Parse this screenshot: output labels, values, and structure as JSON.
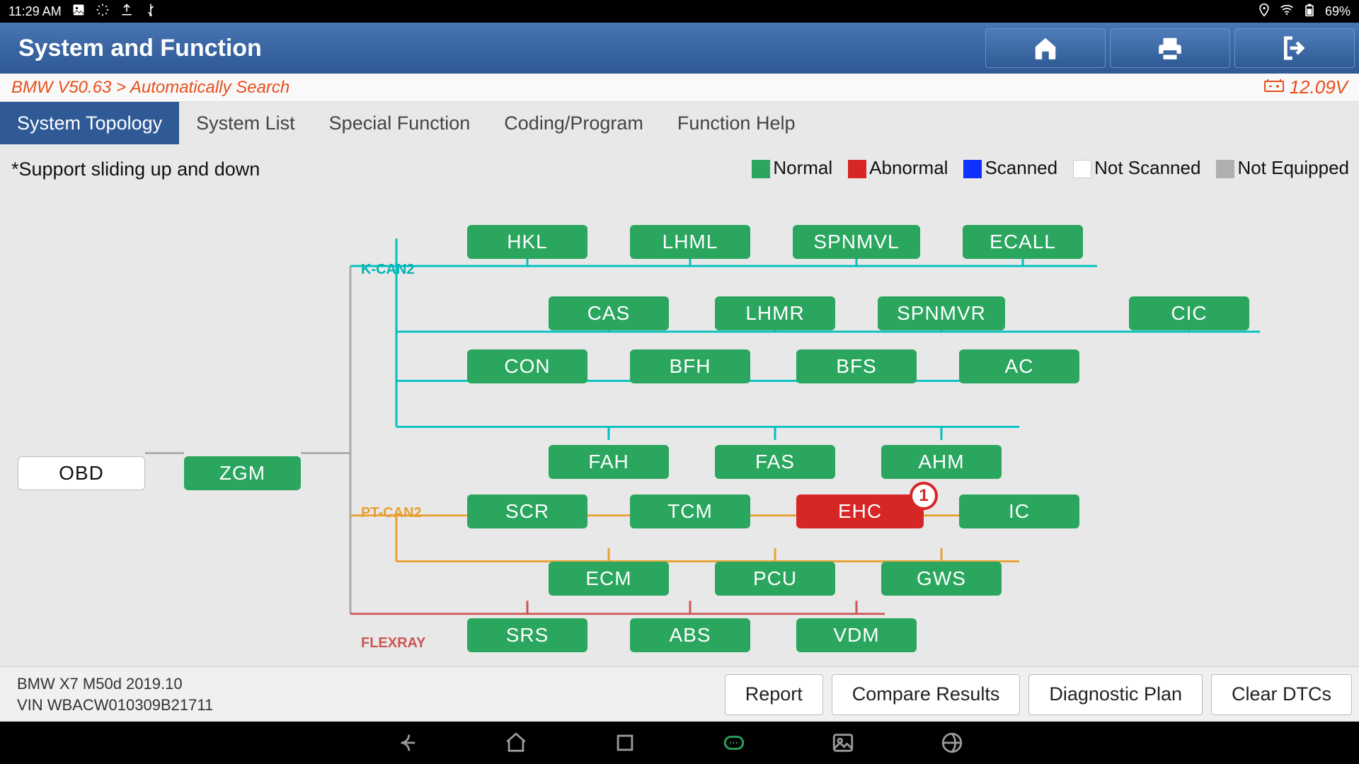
{
  "status": {
    "time": "11:29 AM",
    "battery": "69%"
  },
  "header": {
    "title": "System and Function"
  },
  "crumb": "BMW V50.63 > Automatically Search",
  "voltage": "12.09V",
  "tabs": [
    "System Topology",
    "System List",
    "Special Function",
    "Coding/Program",
    "Function Help"
  ],
  "active_tab": 0,
  "hint": "*Support sliding up and down",
  "legend": {
    "normal": "Normal",
    "abnormal": "Abnormal",
    "scanned": "Scanned",
    "notscanned": "Not Scanned",
    "notequip": "Not Equipped"
  },
  "buses": {
    "kcan2": "K-CAN2",
    "ptcan2": "PT-CAN2",
    "flexray": "FLEXRAY"
  },
  "root_nodes": {
    "obd": "OBD",
    "zgm": "ZGM"
  },
  "topology": {
    "kcan2": {
      "row1": [
        "HKL",
        "LHML",
        "SPNMVL",
        "ECALL"
      ],
      "row2": [
        "CAS",
        "LHMR",
        "SPNMVR",
        "CIC"
      ],
      "row3": [
        "CON",
        "BFH",
        "BFS",
        "AC"
      ],
      "row4": [
        "FAH",
        "FAS",
        "AHM"
      ]
    },
    "ptcan2": {
      "row1": [
        {
          "name": "SCR",
          "status": "normal"
        },
        {
          "name": "TCM",
          "status": "normal"
        },
        {
          "name": "EHC",
          "status": "abnormal",
          "badge": "1"
        },
        {
          "name": "IC",
          "status": "normal"
        }
      ],
      "row2": [
        "ECM",
        "PCU",
        "GWS"
      ]
    },
    "flexray": {
      "row1": [
        "SRS",
        "ABS",
        "VDM"
      ]
    }
  },
  "vehicle": {
    "model": "BMW X7 M50d 2019.10",
    "vin": "VIN WBACW010309B21711"
  },
  "actions": [
    "Report",
    "Compare Results",
    "Diagnostic Plan",
    "Clear DTCs"
  ]
}
